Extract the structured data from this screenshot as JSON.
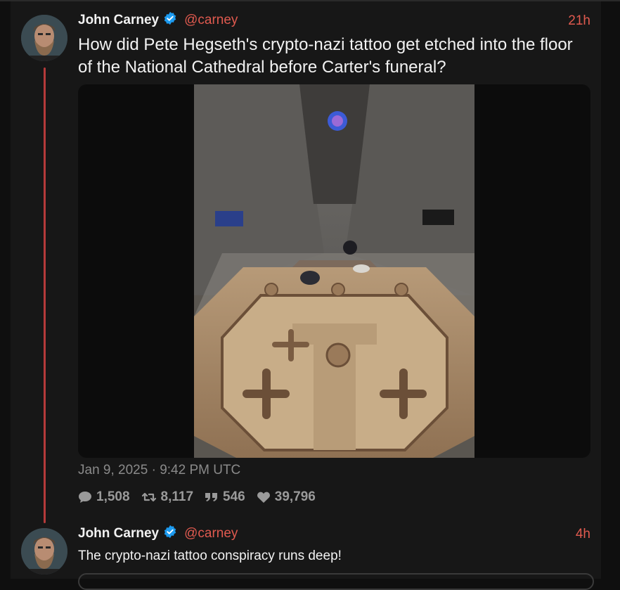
{
  "tweets": [
    {
      "fullname": "John Carney",
      "username": "@carney",
      "time": "21h",
      "text": "How did Pete Hegseth's crypto-nazi tattoo get etched into the floor of the National Cathedral before Carter's funeral?",
      "date": "Jan 9, 2025 · 9:42 PM UTC",
      "stats": {
        "replies": "1,508",
        "retweets": "8,117",
        "quotes": "546",
        "likes": "39,796"
      }
    },
    {
      "fullname": "John Carney",
      "username": "@carney",
      "time": "4h",
      "text": "The crypto-nazi tattoo conspiracy runs deep!"
    }
  ],
  "colors": {
    "accent": "#e05a4f",
    "thread_line": "#b53a3a",
    "verified": "#1d9bf0"
  },
  "icons": [
    "verified-badge-icon",
    "comment-icon",
    "retweet-icon",
    "quote-icon",
    "heart-icon"
  ]
}
